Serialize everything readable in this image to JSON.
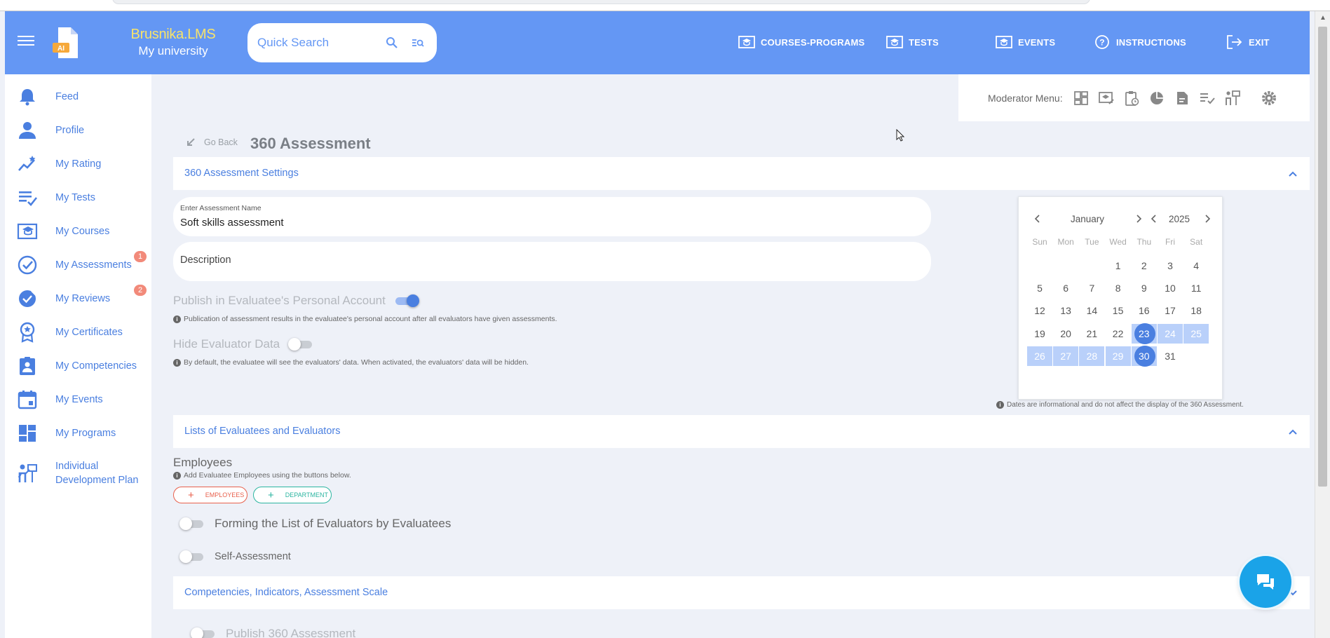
{
  "header": {
    "brand_name": "Brusnika.LMS",
    "brand_sub": "My university",
    "logo_badge": "AI",
    "search_placeholder": "Quick Search",
    "nav": [
      {
        "label": "COURSES-PROGRAMS",
        "icon": "courses-icon"
      },
      {
        "label": "TESTS",
        "icon": "tests-icon"
      },
      {
        "label": "EVENTS",
        "icon": "events-icon"
      },
      {
        "label": "INSTRUCTIONS",
        "icon": "help-icon"
      },
      {
        "label": "EXIT",
        "icon": "exit-icon"
      }
    ]
  },
  "sidebar": {
    "items": [
      {
        "label": "Feed",
        "icon": "bell-icon"
      },
      {
        "label": "Profile",
        "icon": "person-icon"
      },
      {
        "label": "My Rating",
        "icon": "rating-icon"
      },
      {
        "label": "My Tests",
        "icon": "tests-list-icon"
      },
      {
        "label": "My Courses",
        "icon": "courses-icon"
      },
      {
        "label": "My Assessments",
        "icon": "check-circle-icon",
        "badge": "1"
      },
      {
        "label": "My Reviews",
        "icon": "reviews-icon",
        "badge": "2"
      },
      {
        "label": "My Certificates",
        "icon": "certificate-icon"
      },
      {
        "label": "My Competencies",
        "icon": "competencies-icon"
      },
      {
        "label": "My Events",
        "icon": "calendar-icon"
      },
      {
        "label": "My Programs",
        "icon": "dashboard-icon"
      },
      {
        "label": "Individual Development Plan",
        "icon": "development-icon"
      }
    ]
  },
  "moderator": {
    "label": "Moderator Menu:"
  },
  "page": {
    "go_back": "Go Back",
    "title": "360 Assessment"
  },
  "settings": {
    "section_title": "360 Assessment Settings",
    "name_label": "Enter Assessment Name",
    "name_value": "Soft skills assessment",
    "description_placeholder": "Description",
    "publish_label": "Publish in Evaluatee's Personal Account",
    "publish_on": true,
    "publish_hint": "Publication of assessment results in the evaluatee's personal account after all evaluators have given assessments.",
    "hide_label": "Hide Evaluator Data",
    "hide_on": false,
    "hide_hint": "By default, the evaluatee will see the evaluators' data. When activated, the evaluators' data will be hidden.",
    "dates_hint": "Dates are informational and do not affect the display of the 360 Assessment."
  },
  "calendar": {
    "month": "January",
    "year": "2025",
    "weekdays": [
      "Sun",
      "Mon",
      "Tue",
      "Wed",
      "Thu",
      "Fri",
      "Sat"
    ],
    "first_weekday_index": 3,
    "days_in_month": 31,
    "range_start": 23,
    "range_end": 30
  },
  "lists": {
    "section_title": "Lists of Evaluatees and Evaluators",
    "employees_title": "Employees",
    "employees_hint": "Add Evaluatee Employees using the buttons below.",
    "btn_employees": "EMPLOYEES",
    "btn_department": "DEPARTMENT",
    "forming_label": "Forming the List of Evaluators by Evaluatees",
    "self_label": "Self-Assessment"
  },
  "competencies": {
    "section_title": "Competencies, Indicators, Assessment Scale"
  },
  "publish_360": {
    "label": "Publish 360 Assessment"
  },
  "colors": {
    "header_bg": "#6497f4",
    "brand_yellow": "#f7e36a",
    "accent": "#4a7fe0",
    "badge": "#f28a7a",
    "employees_red": "#e8604c",
    "department_teal": "#2bb5a0",
    "chat": "#1aa3e8"
  }
}
